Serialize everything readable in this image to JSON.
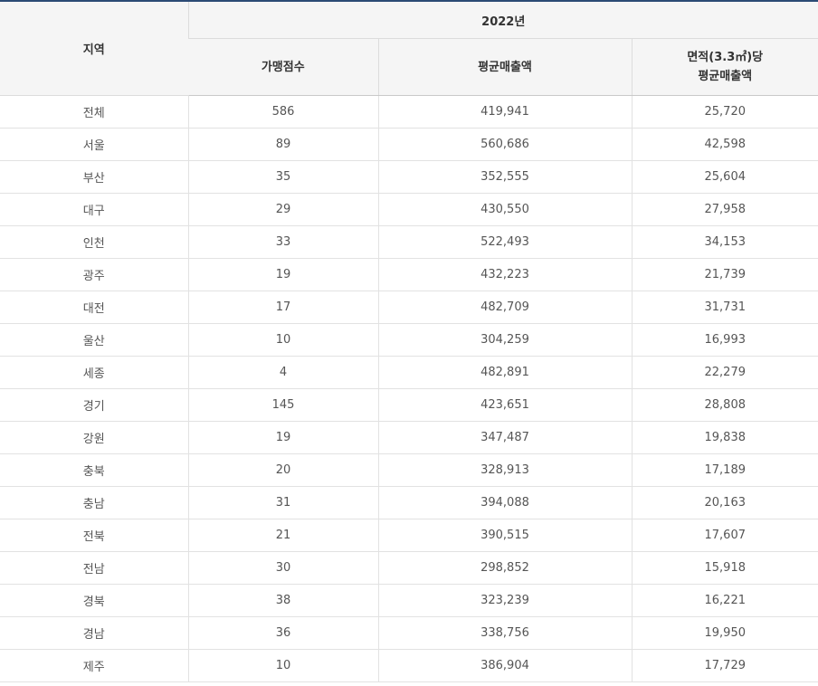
{
  "header": {
    "region": "지역",
    "year": "2022년",
    "stores": "가맹점수",
    "avg_sales": "평균매출액",
    "area_line1": "면적(3.3㎡)당",
    "area_line2": "평균매출액"
  },
  "rows": [
    {
      "region": "전체",
      "stores": "586",
      "avg_sales": "419,941",
      "per_area": "25,720"
    },
    {
      "region": "서울",
      "stores": "89",
      "avg_sales": "560,686",
      "per_area": "42,598"
    },
    {
      "region": "부산",
      "stores": "35",
      "avg_sales": "352,555",
      "per_area": "25,604"
    },
    {
      "region": "대구",
      "stores": "29",
      "avg_sales": "430,550",
      "per_area": "27,958"
    },
    {
      "region": "인천",
      "stores": "33",
      "avg_sales": "522,493",
      "per_area": "34,153"
    },
    {
      "region": "광주",
      "stores": "19",
      "avg_sales": "432,223",
      "per_area": "21,739"
    },
    {
      "region": "대전",
      "stores": "17",
      "avg_sales": "482,709",
      "per_area": "31,731"
    },
    {
      "region": "울산",
      "stores": "10",
      "avg_sales": "304,259",
      "per_area": "16,993"
    },
    {
      "region": "세종",
      "stores": "4",
      "avg_sales": "482,891",
      "per_area": "22,279"
    },
    {
      "region": "경기",
      "stores": "145",
      "avg_sales": "423,651",
      "per_area": "28,808"
    },
    {
      "region": "강원",
      "stores": "19",
      "avg_sales": "347,487",
      "per_area": "19,838"
    },
    {
      "region": "충북",
      "stores": "20",
      "avg_sales": "328,913",
      "per_area": "17,189"
    },
    {
      "region": "충남",
      "stores": "31",
      "avg_sales": "394,088",
      "per_area": "20,163"
    },
    {
      "region": "전북",
      "stores": "21",
      "avg_sales": "390,515",
      "per_area": "17,607"
    },
    {
      "region": "전남",
      "stores": "30",
      "avg_sales": "298,852",
      "per_area": "15,918"
    },
    {
      "region": "경북",
      "stores": "38",
      "avg_sales": "323,239",
      "per_area": "16,221"
    },
    {
      "region": "경남",
      "stores": "36",
      "avg_sales": "338,756",
      "per_area": "19,950"
    },
    {
      "region": "제주",
      "stores": "10",
      "avg_sales": "386,904",
      "per_area": "17,729"
    }
  ]
}
